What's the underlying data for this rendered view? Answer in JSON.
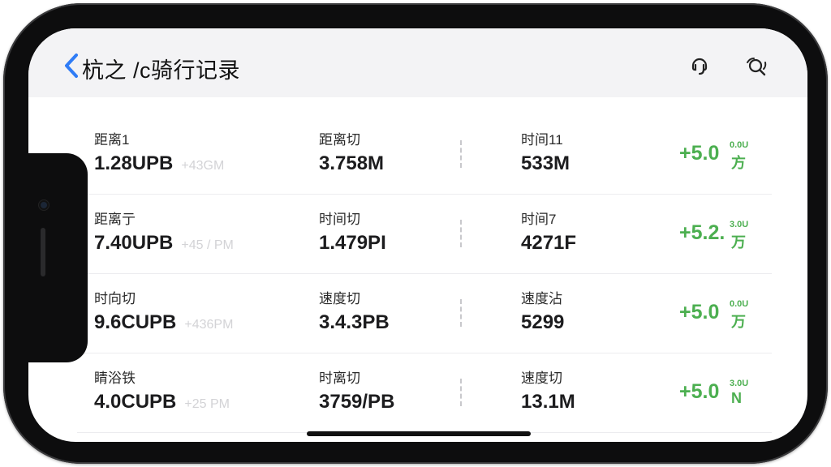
{
  "header": {
    "title": "杭之 /c骑行记录",
    "back_icon": "chevron-left-icon",
    "icons": [
      "support-icon",
      "search-icon"
    ],
    "accent": "#2f7cf6"
  },
  "rows": [
    {
      "c1_label": "距离1",
      "c1_value": "1.28UPB",
      "c1_sub": "+43GM",
      "c2_label": "距离切",
      "c2_value": "3.758M",
      "c3_label": "时间11",
      "c3_value": "533M",
      "delta": "+5.0",
      "delta_top": "0.0U",
      "delta_unit": "方"
    },
    {
      "c1_label": "距离亍",
      "c1_value": "7.40UPB",
      "c1_sub": "+45 / PM",
      "c2_label": "时间切",
      "c2_value": "1.479PI",
      "c3_label": "时间7",
      "c3_value": "4271F",
      "delta": "+5.2.",
      "delta_top": "3.0U",
      "delta_unit": "万"
    },
    {
      "c1_label": "时向切",
      "c1_value": "9.6CUPB",
      "c1_sub": "+436PM",
      "c2_label": "速度切",
      "c2_value": "3.4.3PB",
      "c3_label": "速度沾",
      "c3_value": "5299",
      "delta": "+5.0",
      "delta_top": "0.0U",
      "delta_unit": "万"
    },
    {
      "c1_label": "睛浴铁",
      "c1_value": "4.0CUPB",
      "c1_sub": "+25 PM",
      "c2_label": "时离切",
      "c2_value": "3759/PB",
      "c3_label": "速度切",
      "c3_value": "13.1M",
      "delta": "+5.0",
      "delta_top": "3.0U",
      "delta_unit": "N"
    }
  ],
  "colors": {
    "delta_green": "#4caf50",
    "header_bg": "#f3f3f5"
  }
}
